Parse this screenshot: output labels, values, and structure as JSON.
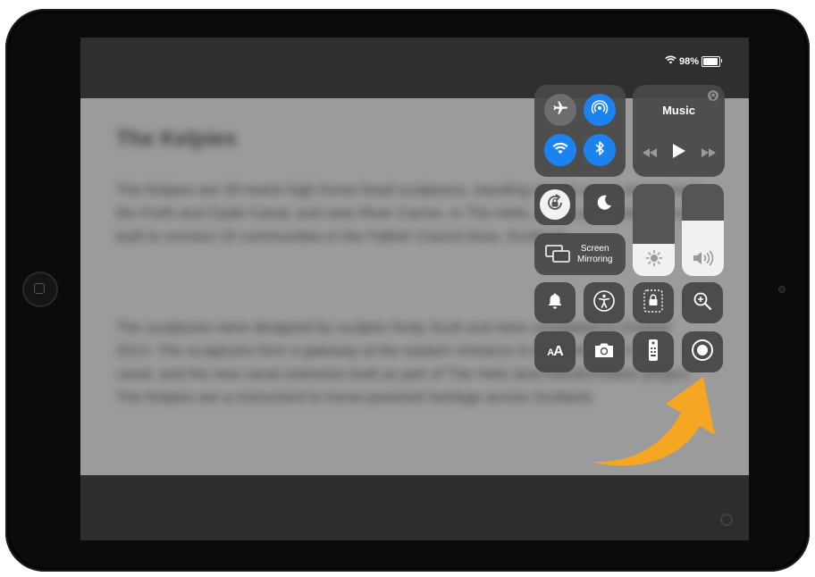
{
  "status": {
    "battery_text": "98%",
    "battery_level": 0.98
  },
  "document": {
    "title": "The Kelpies",
    "para1": "The Kelpies are 30-metre-high horse-head sculptures, standing next to a new extension to the Forth and Clyde Canal, and near River Carron, in The Helix, a new parkland project built to connect 16 communities in the Falkirk Council Area, Scotland.",
    "para2": "The sculptures were designed by sculptor Andy Scott and were completed in October 2013. The sculptures form a gateway at the eastern entrance to the Forth and Clyde canal, and the new canal extension built as part of The Helix land transformation project. The Kelpies are a monument to horse-powered heritage across Scotland."
  },
  "control_center": {
    "music": {
      "title": "Music"
    },
    "screen_mirroring": {
      "line1": "Screen",
      "line2": "Mirroring"
    },
    "brightness": {
      "level": 0.35
    },
    "volume": {
      "level": 0.6
    },
    "icons": {
      "airplane": "airplane-icon",
      "airdrop": "airdrop-icon",
      "wifi": "wifi-icon",
      "bluetooth": "bluetooth-icon",
      "rotation_lock": "rotation-lock-icon",
      "do_not_disturb": "moon-icon",
      "mute": "bell-icon",
      "accessibility": "accessibility-icon",
      "guided_access": "guided-access-icon",
      "magnifier": "magnifier-icon",
      "text_size": "text-size-icon",
      "camera": "camera-icon",
      "remote": "remote-icon",
      "screen_recording": "screen-record-icon"
    },
    "text_size_label": "AA",
    "colors": {
      "active_blue": "#1a83f0",
      "arrow_orange": "#f5a623"
    }
  }
}
